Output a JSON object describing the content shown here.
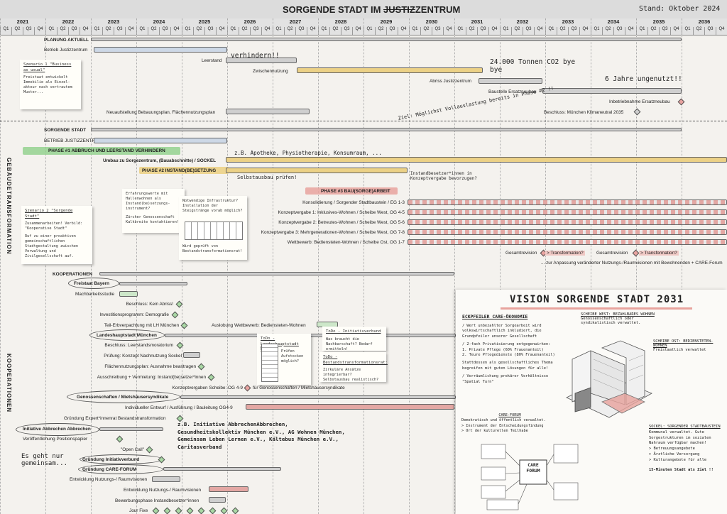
{
  "header": {
    "title_pre": "SORGENDE STADT IM ",
    "title_struck": "JUSTIZ",
    "title_post": "ZENTRUM",
    "stand": "Stand: Oktober 2024"
  },
  "timeline": {
    "years": [
      "2021",
      "2022",
      "2023",
      "2024",
      "2025",
      "2026",
      "2027",
      "2028",
      "2029",
      "2030",
      "2031",
      "2032",
      "2033",
      "2034",
      "2035",
      "2036"
    ],
    "quarters": [
      "Q1",
      "Q2",
      "Q3",
      "Q4"
    ]
  },
  "sections": {
    "planung": "PLANUNG AKTUELL",
    "sorgende": "SORGENDE STADT",
    "gebaeude": "GEBÄUDETRANSFORMATION",
    "kooperationen_side": "KOOPERATIONEN"
  },
  "planung": {
    "betrieb": "Betrieb Justizzentrum",
    "leerstand": "Leerstand",
    "zwischennutzung": "Zwischennutzung",
    "abriss": "Abriss Justizzentrum",
    "baustelle": "Baustelle Ersatzneubau",
    "inbetrieb": "Inbetriebnahme Ersatzneubau",
    "bebauungsplan": "Neuaufstellung Bebauungsplan, Flächennutzungsplan",
    "klimaneutral": "Beschluss: München Klimaneutral 2035",
    "hand_verhindern": "verhindern!!",
    "hand_co2": "24.000 Tonnen CO2 bye bye",
    "hand_jahre": "6 Jahre ungenutzt!!"
  },
  "note1": {
    "title": "Szenario 1 \"Business as usual\"",
    "text": "Freistaat entwickelt Immobilie als Einzel-akteur nach vertrautem Muster..."
  },
  "sorgende": {
    "betrieb": "BETRIEB JUSTIZZENTRUM",
    "phase1": "PHASE #1 ABBRUCH UND LEERSTAND VERHINDERN",
    "umbau": "Umbau zu Sorgezentrum, (Bauabschnitte) / SOCKEL",
    "phase2": "PHASE #2 INSTAND(BE)SETZUNG",
    "phase3": "PHASE #3 BAU(SORGE)ARBEIT",
    "konsolidierung": "Konsolidierung / Sorgender Stadtbaustein / EG 1-3",
    "kv1": "Konzeptvergabe 1: Inklusives-Wohnen / Scheibe West, OG 4-5",
    "kv2": "Konzeptvergabe 2: Betreutes-Wohnen / Scheibe West, OG 5-6",
    "kv3": "Konzeptvergabe 3: Mehrgenerationen-Wohnen / Scheibe West, OG 7-8",
    "wettbewerb": "Wettbewerb: Bediensteten-Wohnen / Scheibe Ost, OG 1-7",
    "gesamtrevision1": "Gesamtrevision",
    "transformation1": "> Transformation?",
    "gesamtrevision2": "Gesamtrevision",
    "transformation2": "> Transformation?",
    "anpassung": "... zur Anpassung veränderter Nutzungs-/Raumvisionen mit Bewohnenden + CARE-Forum",
    "hand_ziel": "Ziel: Möglichst Vollauslastung bereits in Phase #2 !!",
    "hand_apotheke": "z.B. Apotheke, Physiotherapie, Konsumraum, ...",
    "hand_selbstbau": "Selbstausbau prüfen!",
    "hand_instand": "Instandbesetzer*innen in Konzeptvergabe bevorzugen?"
  },
  "note2": {
    "title": "Szenario 2 \"Sorgende Stadt\"",
    "text1": "Zusammenarbeiten! Verbild: \"Kooperative Stadt\"",
    "text2": "Ruf zu einer proaktiven gemeinschaftlichen Stadtgestaltung zwischen Verwaltung und Zivilgesellschaft auf."
  },
  "note3": {
    "text1": "Erfahrungswerte mit Hallenwohnen als Instand(be)setzungs-instrument?",
    "text2": "Zürcher Genossenschaft Kalkbreite kontaktieren!"
  },
  "note4": {
    "text1": "Notwendige Infrastruktur? Installation der Steigstränge vorab möglich?",
    "text2": "Wird geprüft von Bestandstransformationsrat!"
  },
  "koop": {
    "kooperationen": "KOOPERATIONEN",
    "freistaat": "Freistaat Bayern",
    "machbarkeit": "Machbarkeitsstudie",
    "kein_abriss": "Beschluss: Kein Abriss!",
    "invest": "Investitionsprogramm: Demografie",
    "erbpacht": "Teil-Erbverpachtung mit LH München",
    "auslobung": "Auslobung Wettbewerb: Bediensteten-Wohnen",
    "lhm": "Landeshauptstadt München",
    "moratorium": "Beschluss: Leerstandsmoratorium",
    "pruefung": "Prüfung: Konzept Nachnutzung Sockel",
    "flaechennutzung": "Flächennutzungsplan: Ausnahme beantragen",
    "ausschreibung": "Ausschreibung + Vermietung: Instand(be)setzer*innen",
    "konzeptvergaben": "Konzeptvergaben Scheibe: OG 4-9",
    "fuer_gen": "für Genossenschaften / Mietshäusersyndikate",
    "genossenschaften": "Genossenschaften / Mietshäusersyndikate",
    "entwurf": "Individueller Entwurf / Ausführung / Bauleitung OG4-9",
    "gruendung_expert": "Gründung Expert*innenrat  Bestandstransformation",
    "initiative": "Initiative Abbrechen Abbrechen",
    "positionspapier": "Veröffentlichung Positionspapier",
    "open_call": "\"Open Call\"",
    "initiativverbund": "Gründung Initiativverbund",
    "care_forum": "Gründung CARE-FORUM",
    "entwicklung1": "Entwicklung Nutzungs-/ Raumvisionen",
    "entwicklung2": "Entwicklung Nutzungs-/ Raumvisionen",
    "bewerbung": "Bewerbungsphase Instandbesetzer*innen",
    "jour_fixe": "Jour Fixe",
    "hand_gemeinsam": "Es geht nur gemeinsam...",
    "hand_partners": "z.B. Initiative AbbrechenAbbrechen, Gesundheitskollektiv München e.V., AG Wohnen München, Gemeinsam Leben Lernen e.V., Kältebus München e.V., Caritasverband"
  },
  "todo1": {
    "title": "ToDo - Landeshauptstadt Mü:",
    "text": "Prüfen Aufstocken möglich?"
  },
  "todo2": {
    "title": "ToDo - Initiativverbund",
    "text": "Was braucht die Nachbarschaft? Bedarf ermitteln! Durchmischung!!"
  },
  "todo3": {
    "title": "ToDo - Bestandstransformationsrat:",
    "text1": "Zirkuläre Ansätze integrierbar?",
    "text2": "Selbstausbau realistisch?"
  },
  "vision": {
    "title": "VISION SORGENDE STADT 2031",
    "eckpfeiler_title": "ECKPFEILER CARE-ÖKONOMIE",
    "e1": "/ Wert unbezahlter Sorgearbeit wird volkswirtschaftlich inkludiert, die Grundpfeiler unserer Gesellschaft",
    "e2": "/ 2-fach Privatisierung entgegenwirken:",
    "e2a": "1. Private Pflege (60% Frauenanteil)",
    "e2b": "2. Teure Pflegedienste (80% Frauenanteil)",
    "e3": "Stattdessen als gesellschaftliches Thema begreifen mit guten Lösungen für alle!",
    "e4": "/ Verräumlichung prekärer Verhältnisse \"Spatial Turn\"",
    "west_title": "SCHEIBE WEST: BEZAHLBARES WOHNEN",
    "west_text": "Genossenschaftlich oder syndikalistisch verwaltet.",
    "ost_title": "SCHEIBE OST: BEDIENSTETEN-WOHNEN",
    "ost_text": "Freistaatlich verwaltet",
    "sockel_title": "SOCKEL: SORGENDER STADTBAUSTEIN",
    "sockel_text": "Kommunal verwaltet. Gute Sorgestrukturen im sozialen Nahraum verfügbar machen!",
    "sockel_l1": "> Betreuungsangebote",
    "sockel_l2": "> Ärztliche Versorgung",
    "sockel_l3": "> Kulturangebote für alle",
    "sockel_l4": "15-Minuten Stadt als Ziel !!",
    "forum_title": "CARE-FORUM",
    "forum_text": "Demokratisch und öffentlich verwaltet.",
    "forum_l1": "> Instrument der Entscheidungsfindung",
    "forum_l2": "> Ort der kulturellen Teilhabe",
    "care_center": "CARE FORUM"
  },
  "colors": {
    "blue": "#cdd8e6",
    "grey": "#cfcfcf",
    "yellow": "#ecd186",
    "pink": "#e3a7a3",
    "green": "#cde7c9",
    "phase1": "#8fcf8a",
    "phase3": "#e8a39d"
  }
}
